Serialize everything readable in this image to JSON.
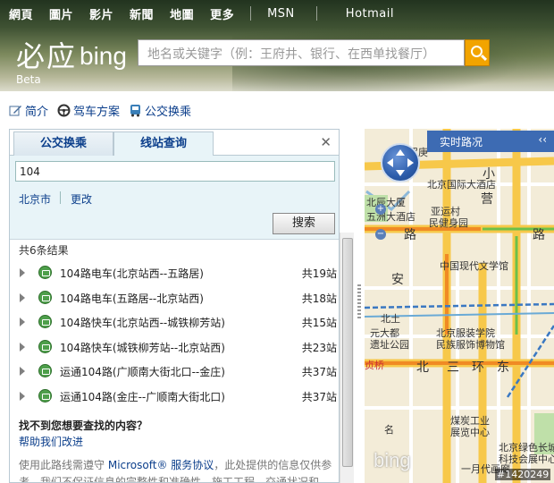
{
  "topnav": {
    "items": [
      "網頁",
      "圖片",
      "影片",
      "新聞",
      "地圖",
      "更多"
    ],
    "msn": "MSN",
    "hotmail": "Hotmail"
  },
  "brand": {
    "logo_cn": "必应",
    "logo_en": "bing",
    "beta": "Beta"
  },
  "search": {
    "placeholder": "地名或关键字（例：王府井、银行、在西单找餐厅）",
    "icon": "search-icon"
  },
  "toolbar": {
    "brief": "简介",
    "driving": "驾车方案",
    "transit": "公交换乘"
  },
  "panel": {
    "tabs": [
      "公交换乘",
      "线站查询"
    ],
    "active_tab": 1,
    "query_value": "104",
    "city": "北京市",
    "change": "更改",
    "search_button": "搜索",
    "count": "共6条结果",
    "results": [
      {
        "name": "104路电车(北京站西--五路居)",
        "stops": "共19站"
      },
      {
        "name": "104路电车(五路居--北京站西)",
        "stops": "共18站"
      },
      {
        "name": "104路快车(北京站西--城铁柳芳站)",
        "stops": "共15站"
      },
      {
        "name": "104路快车(城铁柳芳站--北京站西)",
        "stops": "共23站"
      },
      {
        "name": "运通104路(广顺南大街北口--金庄)",
        "stops": "共37站"
      },
      {
        "name": "运通104路(金庄--广顺南大街北口)",
        "stops": "共37站"
      }
    ],
    "not_found": "找不到您想要查找的内容？",
    "help_improve": "帮助我们改进",
    "disclaimer_prefix": "使用此路线需遵守",
    "disclaimer_link": "Microsoft® 服务协议",
    "disclaimer_suffix": "，此处提供的信息仅供参考。我们不保证信息的完整性和准确性，施工工程、交通状况和"
  },
  "map": {
    "traffic_label": "实时路况",
    "labels": {
      "top_partial": "华罗庚",
      "xiao": "小",
      "ying": "营",
      "hotel": "北京国际大酒店",
      "tower": "北辰大厦",
      "five_star": "五洲大酒店",
      "asian_games": "亚运村",
      "people_house": "民健身园",
      "lu1": "路",
      "lu2": "路",
      "museum": "中国现代文学馆",
      "an": "安",
      "beizhuang": "北京服装学院",
      "beitu": "北土",
      "minzu": "民族服饰博物馆",
      "yuandadu": "元大都",
      "ruins_park": "遗址公园",
      "zhen": "贞桥",
      "bei": "北",
      "san": "三",
      "huan": "环",
      "dong": "东",
      "ming": "名",
      "dd": "东",
      "xhf": "煤炭工业",
      "exhibit": "展览中心",
      "green_vil": "北京绿色长城",
      "science": "科技会展中心",
      "moon": "一月代画廊"
    },
    "watermark": "bing",
    "image_id": "#1420249"
  },
  "colors": {
    "link": "#0b3e8b",
    "tab_bg": "#e8f4f8",
    "bus_green": "#4e9f4b",
    "map_road": "#f7c84a",
    "map_bg": "#f3ecd8"
  }
}
